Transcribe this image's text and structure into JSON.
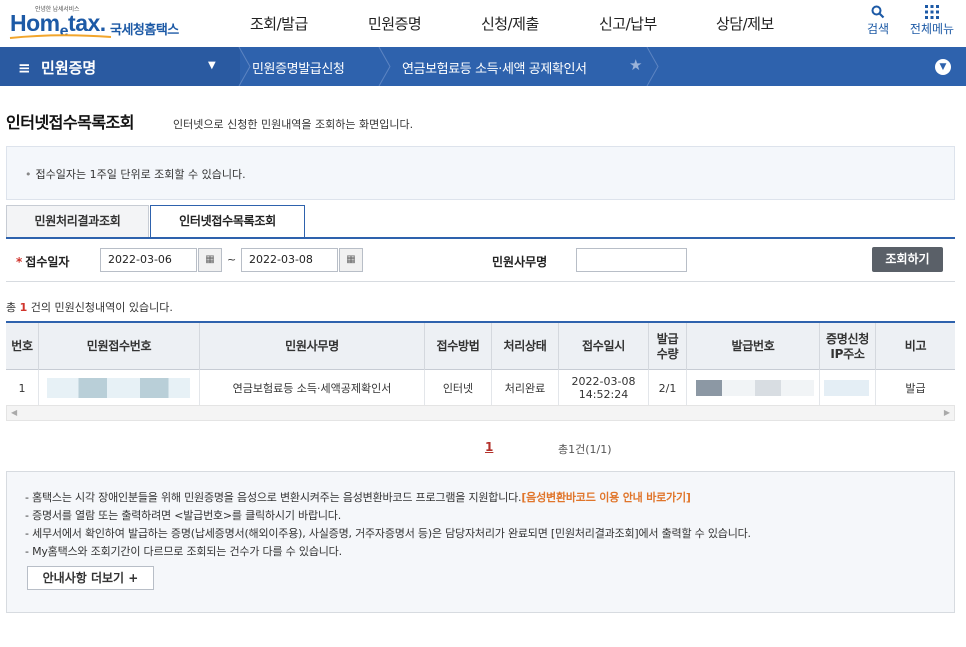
{
  "header": {
    "logo_tiny": "안녕한 납세서비스",
    "logo_brand_a": "Hom",
    "logo_brand_e": "e",
    "logo_brand_b": "tax.",
    "logo_korean": "국세청홈택스",
    "gnb": [
      "조회/발급",
      "민원증명",
      "신청/제출",
      "신고/납부",
      "상담/제보"
    ],
    "search_label": "검색",
    "menu_label": "전체메뉴"
  },
  "navbar": {
    "menu_title": "민원증명",
    "crumb1": "민원증명발급신청",
    "crumb2": "연금보험료등 소득·세액 공제확인서"
  },
  "page": {
    "title": "인터넷접수목록조회",
    "desc": "인터넷으로 신청한 민원내역을 조회하는 화면입니다.",
    "notice": "접수일자는 1주일 단위로 조회할 수 있습니다."
  },
  "tabs": [
    {
      "label": "민원처리결과조회",
      "active": false
    },
    {
      "label": "인터넷접수목록조회",
      "active": true
    }
  ],
  "search": {
    "date_label": "접수일자",
    "date_from": "2022-03-06",
    "date_to": "2022-03-08",
    "tilde": "~",
    "name_label": "민원사무명",
    "name_value": "",
    "button": "조회하기"
  },
  "result": {
    "prefix": "총 ",
    "count": "1",
    "suffix": " 건의 민원신청내역이 있습니다."
  },
  "table": {
    "headers": [
      "번호",
      "민원접수번호",
      "민원사무명",
      "접수방법",
      "처리상태",
      "접수일시",
      "발급\n수량",
      "발급번호",
      "증명신청\nIP주소",
      "비고"
    ],
    "rows": [
      {
        "no": "1",
        "receipt_no": "",
        "service": "연금보험료등 소득·세액공제확인서",
        "method": "인터넷",
        "status": "처리완료",
        "date": "2022-03-08",
        "time": "14:52:24",
        "qty": "2/1",
        "issue_no": "",
        "ip": "",
        "note": "발급"
      }
    ]
  },
  "pagination": {
    "current": "1",
    "total": "총1건(1/1)"
  },
  "guide": {
    "items": [
      {
        "text": "- 홈택스는 시각 장애인분들을 위해 민원증명을 음성으로 변환시켜주는 음성변환바코드 프로그램을 지원합니다.",
        "highlight": "[음성변환바코드 이용 안내 바로가기]"
      },
      {
        "text": "- 증명서를 열람 또는 출력하려면 <발급번호>를 클릭하시기 바랍니다.",
        "highlight": ""
      },
      {
        "text": "- 세무서에서 확인하여 발급하는 증명(납세증명서(해외이주용), 사실증명, 거주자증명서 등)은 담당자처리가 완료되면 [민원처리결과조회]에서 출력할 수 있습니다.",
        "highlight": ""
      },
      {
        "text": "- My홈택스와 조회기간이 다르므로 조회되는 건수가 다를 수 있습니다.",
        "highlight": ""
      }
    ],
    "more_button": "안내사항 더보기 +"
  },
  "colors": {
    "primary": "#2e62ad",
    "accent_red": "#d0342c",
    "highlight_orange": "#e0752a",
    "button_gray": "#5a6068"
  }
}
